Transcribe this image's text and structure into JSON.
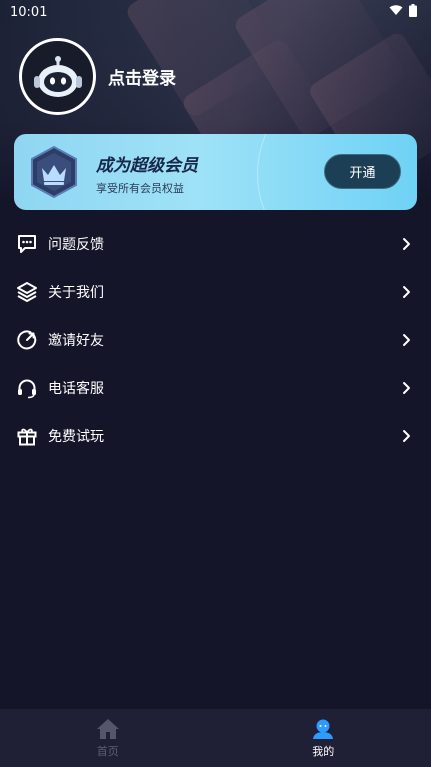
{
  "status_bar": {
    "time": "10:01"
  },
  "profile": {
    "login_label": "点击登录"
  },
  "vip": {
    "title": "成为超级会员",
    "subtitle": "享受所有会员权益",
    "button_label": "开通"
  },
  "menu": {
    "items": [
      {
        "label": "问题反馈",
        "icon": "feedback-icon"
      },
      {
        "label": "关于我们",
        "icon": "layers-icon"
      },
      {
        "label": "邀请好友",
        "icon": "invite-icon"
      },
      {
        "label": "电话客服",
        "icon": "headset-icon"
      },
      {
        "label": "免费试玩",
        "icon": "gift-icon"
      }
    ]
  },
  "tab_bar": {
    "tabs": [
      {
        "label": "首页",
        "icon": "home-icon",
        "active": false
      },
      {
        "label": "我的",
        "icon": "user-icon",
        "active": true
      }
    ]
  },
  "colors": {
    "background": "#15152a",
    "vip_gradient_start": "#8fd6f2",
    "vip_button": "#1d3f55",
    "tab_active_icon": "#2e9bff",
    "tab_inactive": "#5c5c73"
  }
}
